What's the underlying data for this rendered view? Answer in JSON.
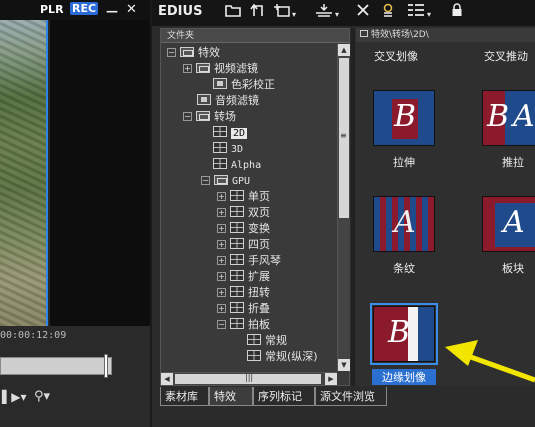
{
  "player": {
    "plr_label": "PLR",
    "rec_label": "REC",
    "minimize_glyph": "—",
    "close_glyph": "✕",
    "timecode": "00:00:12:09",
    "ctrl_left": "▌▶▾",
    "ctrl_right": "⚲▾"
  },
  "bin": {
    "title": "EDIUS",
    "folder_header": "文件夹",
    "tree": {
      "effects": "特效",
      "video_filters": "视频滤镜",
      "color_correction": "色彩校正",
      "audio_filters": "音频滤镜",
      "transitions": "转场",
      "t_2d": "2D",
      "t_3d": "3D",
      "t_alpha": "Alpha",
      "t_gpu": "GPU",
      "g_single": "单页",
      "g_double": "双页",
      "g_transform": "变换",
      "g_quad": "四页",
      "g_accordion": "手风琴",
      "g_expand": "扩展",
      "g_twist": "扭转",
      "g_fold": "折叠",
      "g_clap": "拍板",
      "c_normal": "常规",
      "c_normal_v": "常规(纵深)"
    },
    "path": "特效\\转场\\2D\\",
    "top_labels": [
      "交叉划像",
      "交叉推动"
    ],
    "transitions": [
      {
        "name": "拉伸",
        "letter": "B"
      },
      {
        "name": "推拉",
        "letter": "BA"
      },
      {
        "name": "条纹",
        "letter": "A"
      },
      {
        "name": "板块",
        "letter": "A"
      },
      {
        "name": "边缘划像",
        "letter": "B"
      }
    ],
    "tabs": [
      "素材库",
      "特效",
      "序列标记",
      "源文件浏览"
    ]
  },
  "colors": {
    "accent": "#2b6fd0",
    "thumb_blue": "#1f4a8c",
    "thumb_red": "#8a1a2c",
    "annotation_arrow": "#f2e600"
  }
}
